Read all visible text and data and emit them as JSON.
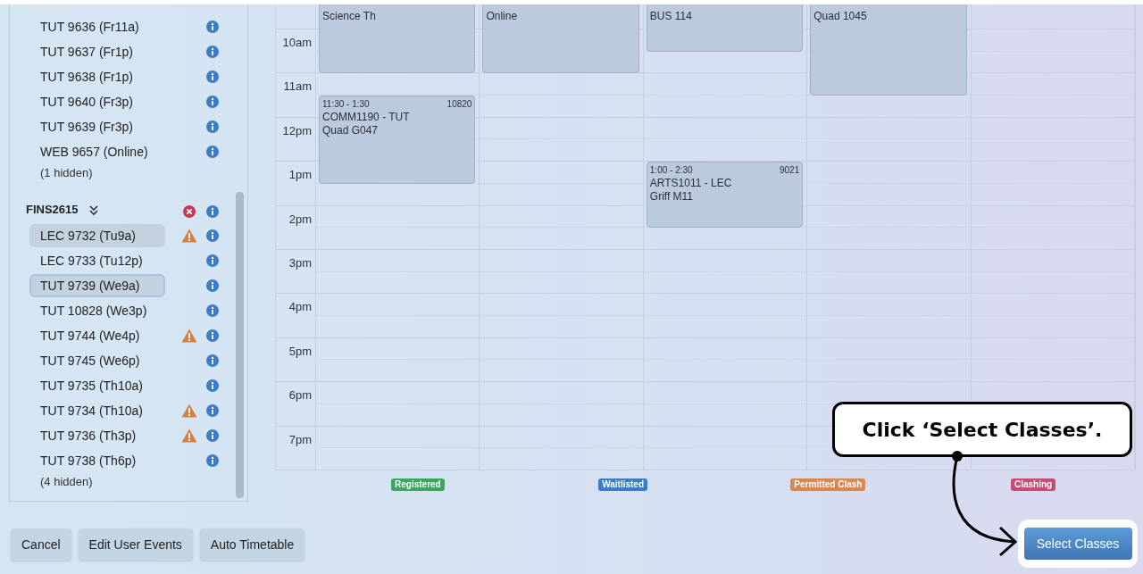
{
  "sidebar": {
    "items": [
      {
        "label": "TUT 9636 (Fr11a)",
        "warning": false,
        "selected": false,
        "focused": false
      },
      {
        "label": "TUT 9637 (Fr1p)",
        "warning": false,
        "selected": false,
        "focused": false
      },
      {
        "label": "TUT 9638 (Fr1p)",
        "warning": false,
        "selected": false,
        "focused": false
      },
      {
        "label": "TUT 9640 (Fr3p)",
        "warning": false,
        "selected": false,
        "focused": false
      },
      {
        "label": "TUT 9639 (Fr3p)",
        "warning": false,
        "selected": false,
        "focused": false
      },
      {
        "label": "WEB 9657 (Online)",
        "warning": false,
        "selected": false,
        "focused": false
      }
    ],
    "hidden_note": "(1 hidden)",
    "group": {
      "title": "FINS2615",
      "expanded": true,
      "clash": true,
      "items": [
        {
          "label": "LEC 9732 (Tu9a)",
          "warning": true,
          "selected": true,
          "focused": false
        },
        {
          "label": "LEC 9733 (Tu12p)",
          "warning": false,
          "selected": false,
          "focused": false
        },
        {
          "label": "TUT 9739 (We9a)",
          "warning": false,
          "selected": true,
          "focused": true
        },
        {
          "label": "TUT 10828 (We3p)",
          "warning": false,
          "selected": false,
          "focused": false
        },
        {
          "label": "TUT 9744 (We4p)",
          "warning": true,
          "selected": false,
          "focused": false
        },
        {
          "label": "TUT 9745 (We6p)",
          "warning": false,
          "selected": false,
          "focused": false
        },
        {
          "label": "TUT 9735 (Th10a)",
          "warning": false,
          "selected": false,
          "focused": false
        },
        {
          "label": "TUT 9734 (Th10a)",
          "warning": true,
          "selected": false,
          "focused": false
        },
        {
          "label": "TUT 9736 (Th3p)",
          "warning": true,
          "selected": false,
          "focused": false
        },
        {
          "label": "TUT 9738 (Th6p)",
          "warning": false,
          "selected": false,
          "focused": false
        }
      ],
      "hidden_note": "(4 hidden)"
    }
  },
  "calendar": {
    "time_labels": [
      "10am",
      "11am",
      "12pm",
      "1pm",
      "2pm",
      "3pm",
      "4pm",
      "5pm",
      "6pm",
      "7pm"
    ],
    "days": [
      {
        "events": [
          {
            "lines": [
              "Science Th"
            ]
          },
          {
            "time": "11:30 - 1:30",
            "code": "10820",
            "lines": [
              "COMM1190 - TUT",
              "Quad G047"
            ]
          }
        ]
      },
      {
        "events": [
          {
            "lines": [
              "Online"
            ]
          }
        ]
      },
      {
        "events": [
          {
            "lines": [
              "BUS 114"
            ]
          },
          {
            "time": "1:00 - 2:30",
            "code": "9021",
            "lines": [
              "ARTS1011 - LEC",
              "Griff M11"
            ]
          }
        ]
      },
      {
        "events": [
          {
            "lines": [
              "Quad 1045"
            ]
          }
        ]
      }
    ]
  },
  "legend": [
    {
      "label": "Registered",
      "color": "#3ea462"
    },
    {
      "label": "Waitlisted",
      "color": "#3b7cc4"
    },
    {
      "label": "Permitted Clash",
      "color": "#d98752"
    },
    {
      "label": "Clashing",
      "color": "#c94a72"
    }
  ],
  "buttons": [
    "Cancel",
    "Edit User Events",
    "Auto Timetable"
  ],
  "primary_button": "Select Classes",
  "callout": "Click ‘Select Classes’."
}
